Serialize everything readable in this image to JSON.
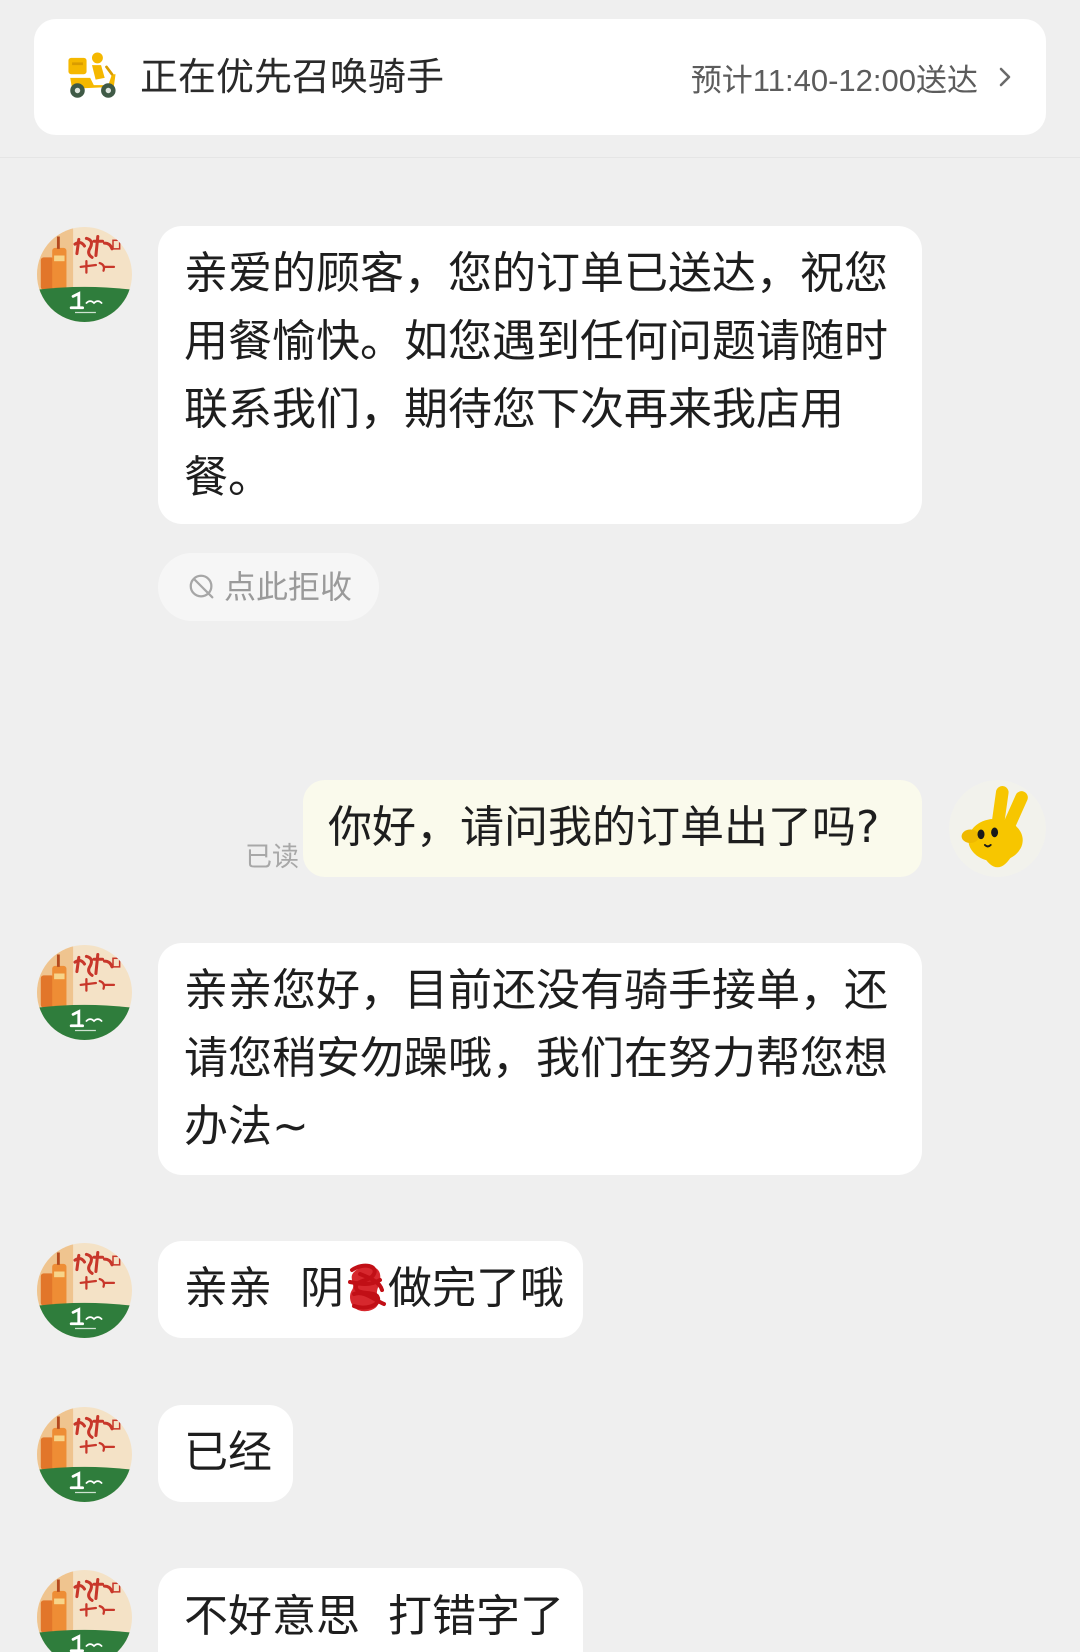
{
  "banner": {
    "icon": "delivery-scooter-icon",
    "status_text": "正在优先召唤骑手",
    "eta_text": "预计11:40-12:00送达",
    "chevron_icon": "chevron-right-icon"
  },
  "colors": {
    "background": "#efefef",
    "incoming_bubble": "#ffffff",
    "outgoing_bubble": "#fafaec",
    "text": "#1e1e1e",
    "muted_text": "#9a9a9a",
    "redaction_ink": "#d4161c",
    "store_logo_green": "#2f7d3c",
    "user_avatar_yellow": "#f7c600"
  },
  "reject_action": {
    "icon": "reject-icon",
    "label": "点此拒收"
  },
  "messages": [
    {
      "outgoing": false,
      "avatar_icon": "store-logo-avatar",
      "lines": [
        "亲爱的顾客，您的订单已送达，祝您",
        "用餐愉快。如您遇到任何问题请随时",
        "联系我们，期待您下次再来我店用",
        "餐。"
      ]
    },
    {
      "outgoing": true,
      "avatar_icon": "user-avatar",
      "text": "你好，请问我的订单出了吗?",
      "read_status": "已读"
    },
    {
      "outgoing": false,
      "avatar_icon": "store-logo-avatar",
      "lines": [
        "亲亲您好，目前还没有骑手接单，还",
        "请您稍安勿躁哦，我们在努力帮您想",
        "办法~"
      ]
    },
    {
      "outgoing": false,
      "avatar_icon": "store-logo-avatar",
      "text_before_redaction": "亲亲  阴",
      "text_after_redaction": "做完了哦"
    },
    {
      "outgoing": false,
      "avatar_icon": "store-logo-avatar",
      "text": "已经"
    },
    {
      "outgoing": false,
      "avatar_icon": "store-logo-avatar",
      "text": "不好意思  打错字了"
    }
  ]
}
